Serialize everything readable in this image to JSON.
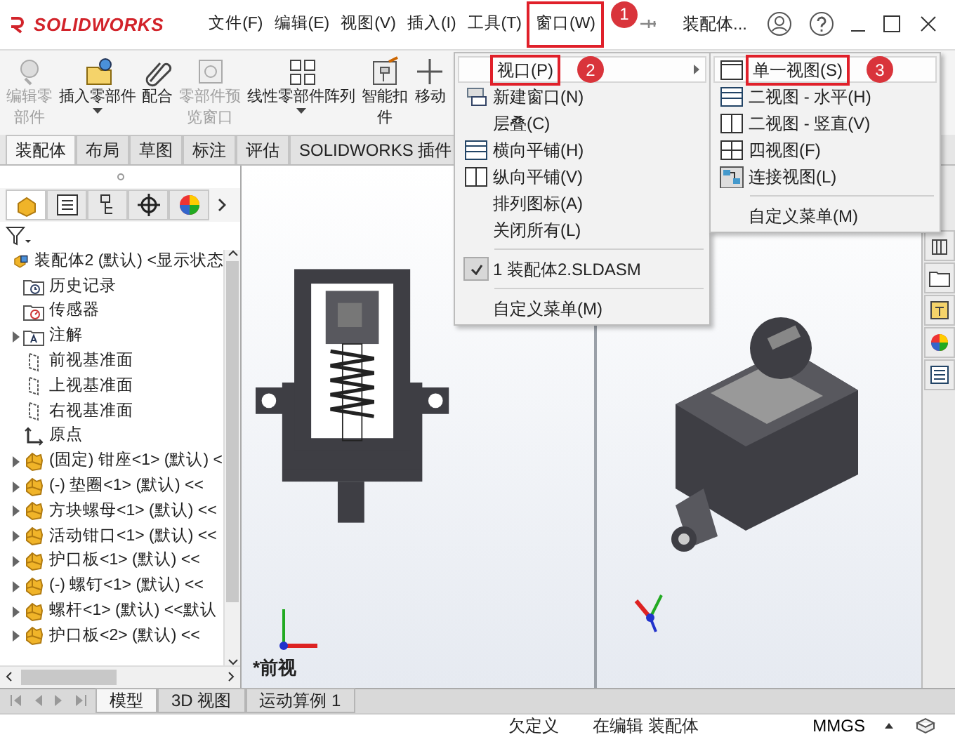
{
  "logo": {
    "text": "SOLIDWORKS"
  },
  "menubar": [
    {
      "label": "文件(F)",
      "selected": false
    },
    {
      "label": "编辑(E)",
      "selected": false
    },
    {
      "label": "视图(V)",
      "selected": false
    },
    {
      "label": "插入(I)",
      "selected": false
    },
    {
      "label": "工具(T)",
      "selected": false
    },
    {
      "label": "窗口(W)",
      "selected": true,
      "step": "1"
    }
  ],
  "document_title": "装配体...",
  "toolbar": [
    {
      "label": "编辑零部件",
      "kind": "edit",
      "disabled": true,
      "dropdown": false
    },
    {
      "label": "插入零部件",
      "kind": "insert",
      "disabled": false,
      "dropdown": true
    },
    {
      "label": "配合",
      "kind": "mate",
      "disabled": false,
      "dropdown": false
    },
    {
      "label": "零部件预览窗口",
      "kind": "preview",
      "disabled": true,
      "dropdown": false
    },
    {
      "label": "线性零部件阵列",
      "kind": "pattern",
      "disabled": false,
      "dropdown": true
    },
    {
      "label": "智能扣件",
      "kind": "fastener",
      "disabled": false,
      "dropdown": false
    },
    {
      "label": "移动",
      "kind": "move",
      "disabled": false,
      "dropdown": false
    }
  ],
  "ribbon_tabs": [
    {
      "label": "装配体",
      "selected": true
    },
    {
      "label": "布局",
      "selected": false
    },
    {
      "label": "草图",
      "selected": false
    },
    {
      "label": "标注",
      "selected": false
    },
    {
      "label": "评估",
      "selected": false
    },
    {
      "label": "SOLIDWORKS 插件",
      "selected": false
    }
  ],
  "panel_tabs": [
    {
      "kind": "tree",
      "selected": true
    },
    {
      "kind": "property",
      "selected": false
    },
    {
      "kind": "config",
      "selected": false
    },
    {
      "kind": "target",
      "selected": false
    },
    {
      "kind": "appearance",
      "selected": false
    }
  ],
  "feature_tree": {
    "label": "装配体2 (默认) <显示状态",
    "kind": "assembly",
    "expander": false,
    "children": [
      {
        "label": "历史记录",
        "kind": "history",
        "expander": false
      },
      {
        "label": "传感器",
        "kind": "sensor",
        "expander": false
      },
      {
        "label": "注解",
        "kind": "annotation",
        "expander": true
      },
      {
        "label": "前视基准面",
        "kind": "plane",
        "expander": false
      },
      {
        "label": "上视基准面",
        "kind": "plane",
        "expander": false
      },
      {
        "label": "右视基准面",
        "kind": "plane",
        "expander": false
      },
      {
        "label": "原点",
        "kind": "origin",
        "expander": false
      },
      {
        "label": "(固定) 钳座<1> (默认) <",
        "kind": "part",
        "expander": true
      },
      {
        "label": "(-) 垫圈<1> (默认) <<",
        "kind": "part",
        "expander": true
      },
      {
        "label": "方块螺母<1> (默认) <<",
        "kind": "part",
        "expander": true
      },
      {
        "label": "活动钳口<1> (默认) <<",
        "kind": "part",
        "expander": true
      },
      {
        "label": "护口板<1> (默认) <<",
        "kind": "part",
        "expander": true
      },
      {
        "label": "(-) 螺钉<1> (默认) <<",
        "kind": "part",
        "expander": true
      },
      {
        "label": "螺杆<1> (默认) <<默认",
        "kind": "part",
        "expander": true
      },
      {
        "label": "护口板<2> (默认) <<",
        "kind": "part",
        "expander": true
      }
    ]
  },
  "graphics": {
    "view_label": "*前视"
  },
  "bottom_tabs": [
    {
      "label": "模型",
      "selected": true
    },
    {
      "label": "3D 视图",
      "selected": false
    },
    {
      "label": "运动算例 1",
      "selected": false
    }
  ],
  "status_bar": {
    "state": "欠定义",
    "mode": "在编辑 装配体",
    "units": "MMGS"
  },
  "window_menu": [
    {
      "label": "视口(P)",
      "kind": "submenu",
      "selected": true,
      "checked": false,
      "step": "2"
    },
    {
      "label": "新建窗口(N)",
      "kind": "new-window",
      "selected": false,
      "checked": false
    },
    {
      "label": "层叠(C)",
      "kind": "plain",
      "selected": false,
      "checked": false
    },
    {
      "label": "横向平铺(H)",
      "kind": "tile-h",
      "selected": false,
      "checked": false
    },
    {
      "label": "纵向平铺(V)",
      "kind": "tile-v",
      "selected": false,
      "checked": false
    },
    {
      "label": "排列图标(A)",
      "kind": "plain",
      "selected": false,
      "checked": false
    },
    {
      "label": "关闭所有(L)",
      "kind": "plain",
      "selected": false,
      "checked": false
    },
    {
      "kind": "separator"
    },
    {
      "label": "1 装配体2.SLDASM",
      "kind": "plain",
      "selected": false,
      "checked": true
    },
    {
      "kind": "separator"
    },
    {
      "label": "自定义菜单(M)",
      "kind": "plain",
      "selected": false,
      "checked": false
    }
  ],
  "viewport_submenu": [
    {
      "label": "单一视图(S)",
      "kind": "single",
      "selected": true,
      "step": "3"
    },
    {
      "label": "二视图 - 水平(H)",
      "kind": "tile-h",
      "selected": false
    },
    {
      "label": "二视图 - 竖直(V)",
      "kind": "tile-v",
      "selected": false
    },
    {
      "label": "四视图(F)",
      "kind": "quad",
      "selected": false
    },
    {
      "label": "连接视图(L)",
      "kind": "link",
      "selected": false
    },
    {
      "kind": "separator"
    },
    {
      "label": "自定义菜单(M)",
      "kind": "plain",
      "selected": false
    }
  ]
}
